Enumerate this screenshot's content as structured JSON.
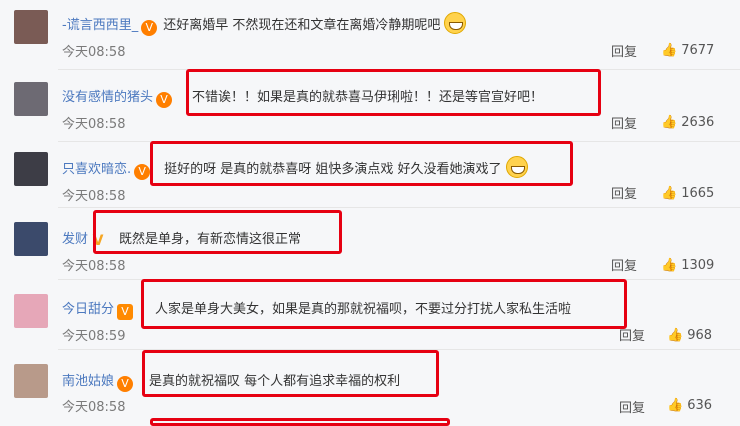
{
  "comments": [
    {
      "username": "-谎言西西里_",
      "badge": "vip",
      "text": "还好离婚早 不然现在还和文章在离婚冷静期呢吧",
      "time": "今天08:58",
      "reply_label": "回复",
      "likes": "7677",
      "avatar_color": "#7a5b55"
    },
    {
      "username": "没有感情的猪头",
      "badge": "vip",
      "text": "不错诶！！如果是真的就恭喜马伊琍啦！！还是等官宣好吧！",
      "time": "今天08:58",
      "reply_label": "回复",
      "likes": "2636",
      "avatar_color": "#6d6a73"
    },
    {
      "username": "只喜欢暗恋.",
      "badge": "vip",
      "text": "挺好的呀 是真的就恭喜呀 姐快多演点戏 好久没看她演戏了",
      "time": "今天08:58",
      "reply_label": "回复",
      "likes": "1665",
      "avatar_color": "#3d3d46"
    },
    {
      "username": "发财",
      "badge": "v",
      "text": "既然是单身，有新恋情这很正常",
      "time": "今天08:58",
      "reply_label": "回复",
      "likes": "1309",
      "avatar_color": "#3b4a6b"
    },
    {
      "username": "今日甜分",
      "badge": "vip",
      "text": "人家是单身大美女，如果是真的那就祝福呗，不要过分打扰人家私生活啦",
      "time": "今天08:59",
      "reply_label": "回复",
      "likes": "968",
      "avatar_color": "#e6a7b8"
    },
    {
      "username": "南池姑娘",
      "badge": "vip",
      "text": "是真的就祝福叹 每个人都有追求幸福的权利",
      "time": "今天08:58",
      "reply_label": "回复",
      "likes": "636",
      "avatar_color": "#b89a8a"
    }
  ],
  "badge_label": "V",
  "icons": {
    "like": "thumbs-up-icon",
    "emoji_grin": "grin-emoji",
    "emoji_scared": "fear-emoji"
  },
  "colors": {
    "username": "#4c79bf",
    "highlight_box": "#e60012",
    "background": "#f6f7f9"
  }
}
